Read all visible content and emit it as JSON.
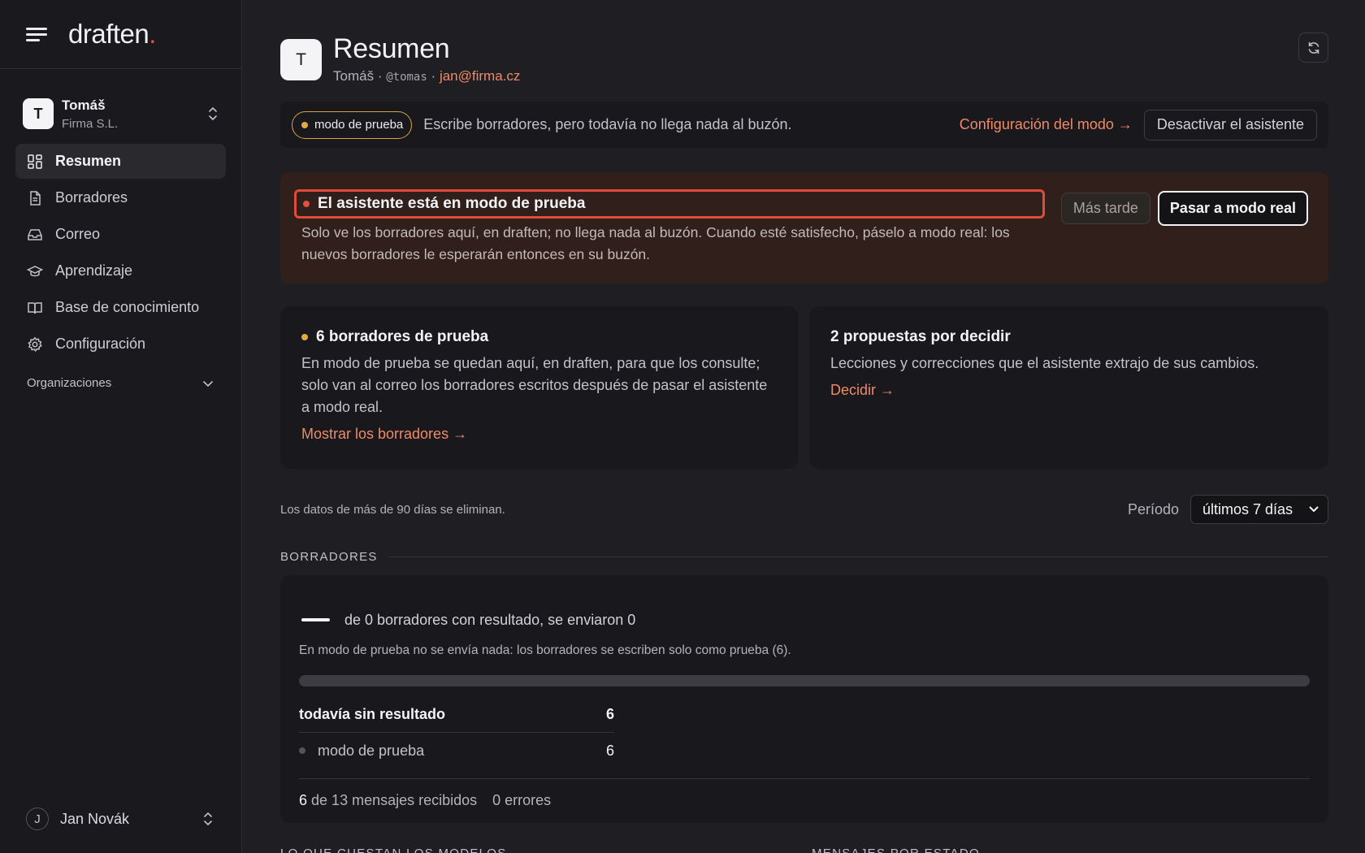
{
  "brand": {
    "name": "draften",
    "dot": "."
  },
  "org": {
    "initial": "T",
    "user": "Tomáš",
    "company": "Firma S.L."
  },
  "nav": [
    {
      "label": "Resumen",
      "icon": "dashboard-icon",
      "active": true
    },
    {
      "label": "Borradores",
      "icon": "document-icon",
      "active": false
    },
    {
      "label": "Correo",
      "icon": "inbox-icon",
      "active": false
    },
    {
      "label": "Aprendizaje",
      "icon": "graduation-cap-icon",
      "active": false
    },
    {
      "label": "Base de conocimiento",
      "icon": "book-icon",
      "active": false
    },
    {
      "label": "Configuración",
      "icon": "gear-icon",
      "active": false
    }
  ],
  "organizations_label": "Organizaciones",
  "footer_user": {
    "initial": "J",
    "name": "Jan Novák"
  },
  "header": {
    "initial": "T",
    "title": "Resumen",
    "name": "Tomáš",
    "sep": "·",
    "handle": "@tomas",
    "email": "jan@firma.cz"
  },
  "mode_bar": {
    "pill": "modo de prueba",
    "description": "Escribe borradores, pero todavía no llega nada al buzón.",
    "config_link": "Configuración del modo →",
    "deactivate": "Desactivar el asistente"
  },
  "test_panel": {
    "title": "El asistente está en modo de prueba",
    "description": "Solo ve los borradores aquí, en draften; no llega nada al buzón. Cuando esté satisfecho, páselo a modo real: los nuevos borradores le esperarán entonces en su buzón.",
    "later": "Más tarde",
    "go_real": "Pasar a modo real"
  },
  "cards": [
    {
      "title": "6 borradores de prueba",
      "body": "En modo de prueba se quedan aquí, en draften, para que los consulte; solo van al correo los borradores escritos después de pasar el asistente a modo real.",
      "link": "Mostrar los borradores →"
    },
    {
      "title": "2 propuestas por decidir",
      "body": "Lecciones y correcciones que el asistente extrajo de sus cambios.",
      "link": "Decidir →"
    }
  ],
  "retention_note": "Los datos de más de 90 días se eliminan.",
  "period": {
    "label": "Período",
    "value": "últimos 7 días"
  },
  "drafts_section": {
    "heading": "BORRADORES",
    "summary": "de 0 borradores con resultado, se enviaron 0",
    "note": "En modo de prueba no se envía nada: los borradores se escriben solo como prueba (6).",
    "progress_fraction": 0,
    "rows": [
      {
        "label": "todavía sin resultado",
        "value": "6"
      },
      {
        "label": "modo de prueba",
        "value": "6"
      }
    ],
    "received_count": "6",
    "received_text": "de 13 mensajes recibidos",
    "errors": "0 errores"
  },
  "bottom_headings": [
    "LO QUE CUESTAN LOS MODELOS",
    "MENSAJES POR ESTADO"
  ],
  "colors": {
    "accent": "#ee8a66",
    "amber": "#e2ab42",
    "alert": "#e14b3a"
  }
}
